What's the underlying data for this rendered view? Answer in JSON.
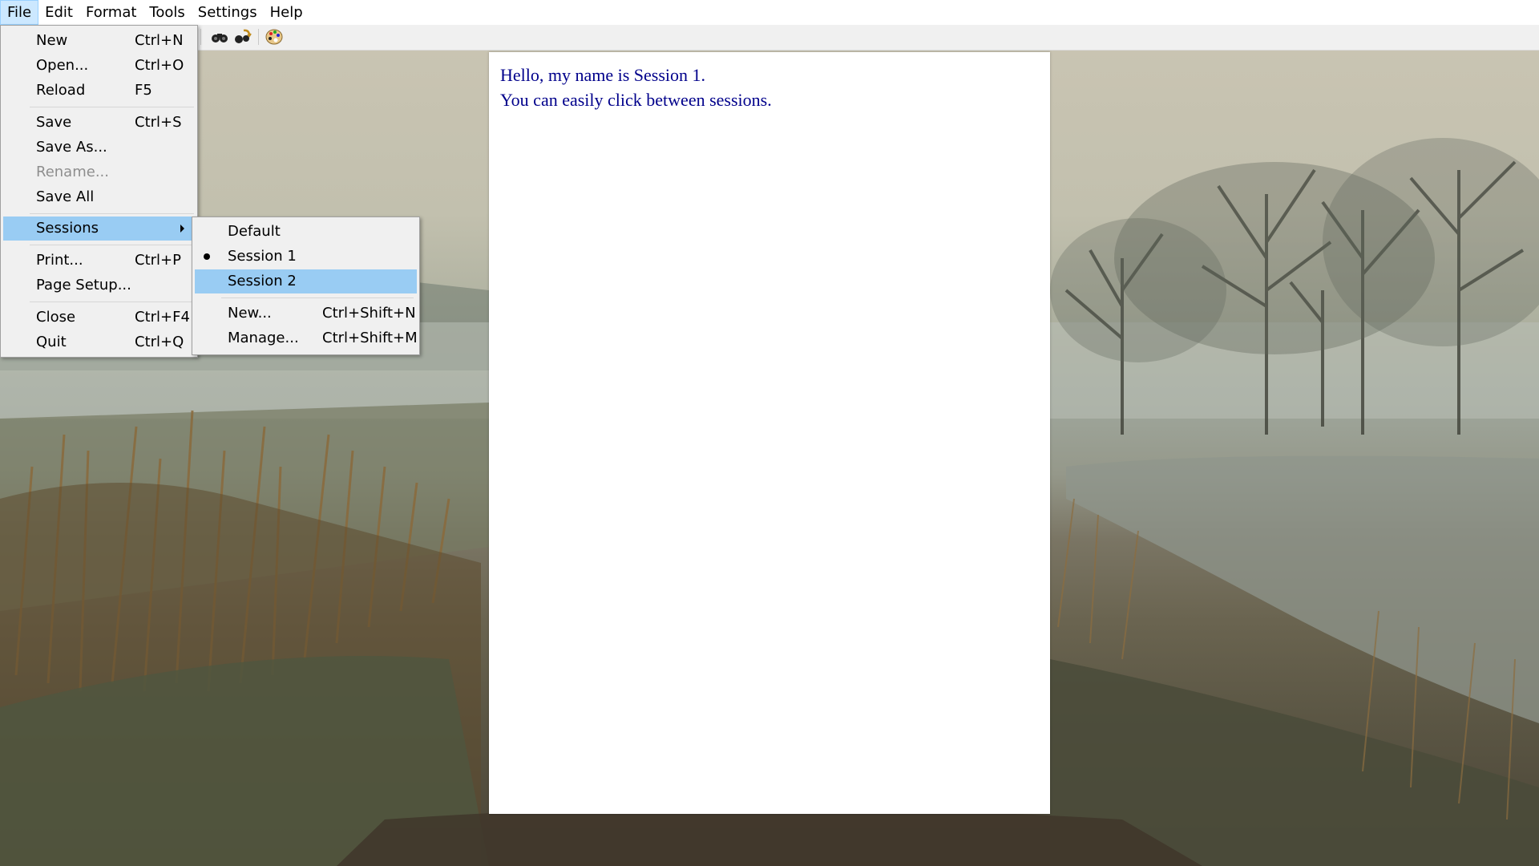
{
  "menubar": {
    "items": [
      "File",
      "Edit",
      "Format",
      "Tools",
      "Settings",
      "Help"
    ]
  },
  "toolbar": {
    "icons": [
      "binoculars-icon",
      "find-replace-icon",
      "palette-icon"
    ]
  },
  "document": {
    "lines": [
      "Hello, my name is Session 1.",
      "You can easily click between sessions."
    ],
    "text_color": "#00008b"
  },
  "file_menu": {
    "items": [
      {
        "label": "New",
        "shortcut": "Ctrl+N"
      },
      {
        "label": "Open...",
        "shortcut": "Ctrl+O"
      },
      {
        "label": "Reload",
        "shortcut": "F5"
      },
      {
        "label": "Save",
        "shortcut": "Ctrl+S"
      },
      {
        "label": "Save As...",
        "shortcut": ""
      },
      {
        "label": "Rename...",
        "shortcut": "",
        "disabled": true
      },
      {
        "label": "Save All",
        "shortcut": ""
      },
      {
        "label": "Sessions",
        "shortcut": "",
        "submenu": true
      },
      {
        "label": "Print...",
        "shortcut": "Ctrl+P"
      },
      {
        "label": "Page Setup...",
        "shortcut": ""
      },
      {
        "label": "Close",
        "shortcut": "Ctrl+F4"
      },
      {
        "label": "Quit",
        "shortcut": "Ctrl+Q"
      }
    ]
  },
  "sessions_menu": {
    "items": [
      {
        "label": "Default",
        "shortcut": ""
      },
      {
        "label": "Session 1",
        "shortcut": "",
        "checked": true
      },
      {
        "label": "Session 2",
        "shortcut": "",
        "highlighted": true
      },
      {
        "label": "New...",
        "shortcut": "Ctrl+Shift+N"
      },
      {
        "label": "Manage...",
        "shortcut": "Ctrl+Shift+M"
      }
    ]
  },
  "colors": {
    "menu_highlight": "#99ccf3",
    "menubar_active": "#cce8ff"
  }
}
